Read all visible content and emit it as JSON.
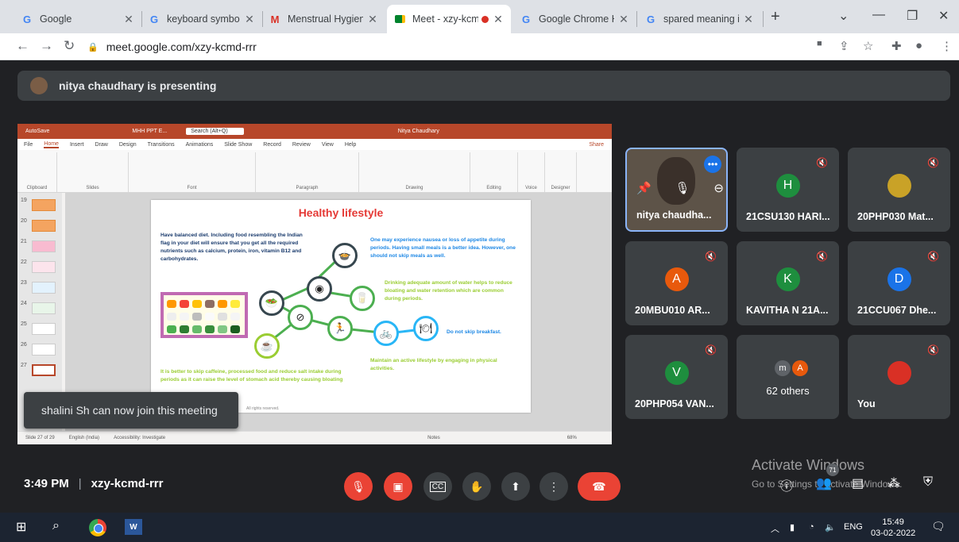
{
  "browser": {
    "tabs": [
      {
        "title": "Google",
        "icon": "google-icon",
        "active": false
      },
      {
        "title": "keyboard symbols",
        "icon": "google-icon",
        "active": false
      },
      {
        "title": "Menstrual Hygiene",
        "icon": "gmail-icon",
        "active": false
      },
      {
        "title": "Meet - xzy-kcm",
        "icon": "meet-icon",
        "active": true
      },
      {
        "title": "Google Chrome He",
        "icon": "google-icon",
        "active": false
      },
      {
        "title": "spared meaning in",
        "icon": "google-icon",
        "active": false
      }
    ],
    "url": "meet.google.com/xzy-kcmd-rrr"
  },
  "meet": {
    "presenting_banner": "nitya chaudhary is presenting",
    "toast": "shalini Sh can now join this meeting",
    "time": "3:49 PM",
    "meeting_code": "xzy-kcmd-rrr",
    "participants": [
      {
        "name": "nitya chaudha...",
        "video": true
      },
      {
        "name": "21CSU130 HARI...",
        "initial": "H",
        "color": "#1e8e3e"
      },
      {
        "name": "20PHP030 Mat...",
        "initial": "",
        "color": "#c9a227"
      },
      {
        "name": "20MBU010 AR...",
        "initial": "A",
        "color": "#e8590c"
      },
      {
        "name": "KAVITHA N 21A...",
        "initial": "K",
        "color": "#1e8e3e"
      },
      {
        "name": "21CCU067 Dhe...",
        "initial": "D",
        "color": "#1a73e8"
      },
      {
        "name": "20PHP054 VAN...",
        "initial": "V",
        "color": "#1e8e3e"
      },
      {
        "name": "You",
        "initial": "",
        "color": "#d93025"
      }
    ],
    "others": {
      "label": "62 others",
      "avatars": [
        "m",
        "A"
      ]
    },
    "people_count": "71",
    "activate": {
      "title": "Activate Windows",
      "subtitle": "Go to Settings to activate Windows."
    }
  },
  "ppt": {
    "autosave": "AutoSave",
    "filename": "MHH PPT E...",
    "search": "Search (Alt+Q)",
    "user": "Nitya Chaudhary",
    "ribbon_tabs": [
      "File",
      "Home",
      "Insert",
      "Draw",
      "Design",
      "Transitions",
      "Animations",
      "Slide Show",
      "Record",
      "Review",
      "View",
      "Help"
    ],
    "share": "Share",
    "groups": [
      "Clipboard",
      "Slides",
      "Font",
      "Paragraph",
      "Drawing",
      "Editing",
      "Voice",
      "Designer"
    ],
    "thumb_numbers": [
      "19",
      "20",
      "21",
      "22",
      "23",
      "24",
      "25",
      "26",
      "27"
    ],
    "status_slide": "Slide 27 of 29",
    "status_lang": "English (India)",
    "status_access": "Accessibility: Investigate",
    "status_notes": "Notes",
    "status_zoom": "68%",
    "footer": "All rights reserved.",
    "slide": {
      "title": "Healthy lifestyle",
      "t1": "Have balanced diet. Including food resembling the Indian flag in your diet will ensure that you get all the required nutrients such as calcium, protein, iron, vitamin B12 and carbohydrates.",
      "t2": "One may experience nausea or loss of appetite during periods. Having small meals is a better idea. However, one should not skip meals as well.",
      "t3": "Drinking adequate amount of water helps to reduce bloating and water retention which are common during periods.",
      "t4": "Do not skip breakfast.",
      "t5": "Maintain an active lifestyle by engaging in physical activities.",
      "t6": "It is better to skip caffeine, processed food and reduce salt intake during periods as it can raise the level of stomach acid thereby causing bloating"
    }
  },
  "taskbar": {
    "lang": "ENG",
    "time": "15:49",
    "date": "03-02-2022"
  }
}
